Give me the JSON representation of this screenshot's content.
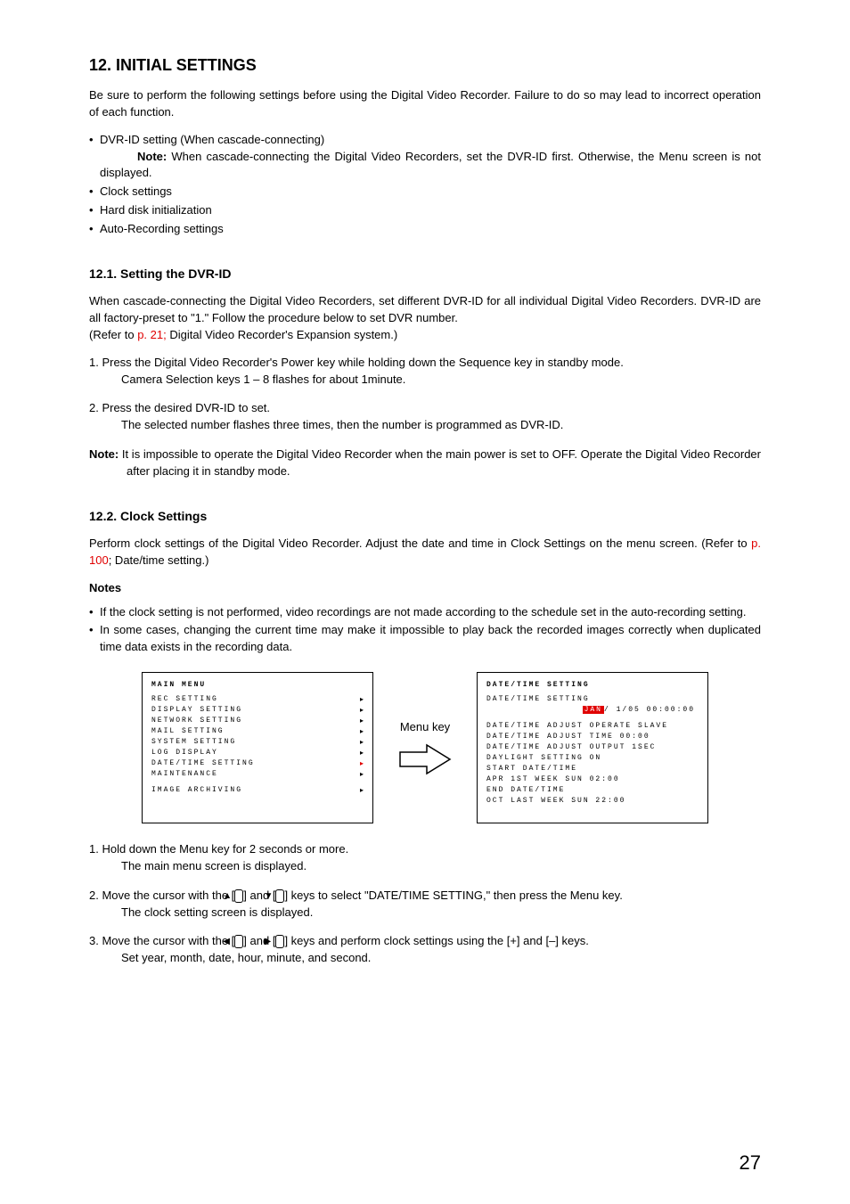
{
  "section": {
    "title": "12. INITIAL SETTINGS",
    "intro": "Be sure to perform the following settings before using the Digital Video Recorder. Failure to do so may lead to incorrect operation of each function.",
    "bullets": {
      "b1": "DVR-ID setting (When cascade-connecting)",
      "b1note_label": "Note:",
      "b1note": " When cascade-connecting the Digital Video Recorders, set the DVR-ID first. Otherwise, the Menu screen is not displayed.",
      "b2": "Clock settings",
      "b3": "Hard disk initialization",
      "b4": "Auto-Recording settings"
    }
  },
  "sub1": {
    "title": "12.1. Setting the DVR-ID",
    "p1a": "When cascade-connecting the Digital Video Recorders, set different DVR-ID for all individual Digital Video Recorders. DVR-ID are all factory-preset to \"1.\" Follow the procedure below to set DVR number.",
    "p1b_prefix": "(Refer to ",
    "p1b_link": "p. 21;",
    "p1b_suffix": " Digital Video Recorder's Expansion system.)",
    "s1": "1. Press the Digital Video Recorder's Power key while holding down the Sequence key in standby mode.",
    "s1b": "Camera Selection keys 1 – 8 flashes for about 1minute.",
    "s2": "2. Press the desired DVR-ID to set.",
    "s2b": "The selected number flashes three times, then the number is programmed as DVR-ID.",
    "note_label": "Note:",
    "note": " It is impossible to operate the Digital Video Recorder when the main power is set to OFF. Operate the Digital Video Recorder after placing it in standby mode."
  },
  "sub2": {
    "title": "12.2. Clock Settings",
    "p1_prefix": "Perform clock settings of the Digital Video Recorder. Adjust the date and time in Clock Settings on the menu screen. (Refer to ",
    "p1_link": "p. 100",
    "p1_suffix": "; Date/time setting.)",
    "notes_heading": "Notes",
    "n1": "If the clock setting is not performed, video recordings are not made according to the schedule set in the auto-recording setting.",
    "n2": "In some cases, changing the current time may make it impossible to play back the recorded images correctly when duplicated time data exists in the recording data.",
    "step1": "1. Hold down the Menu key for 2 seconds or more.",
    "step1b": "The main menu screen is displayed.",
    "step2a": "2. Move the cursor with the [",
    "step2b": "] and [",
    "step2c": "] keys to select \"DATE/TIME SETTING,\" then press the Menu key.",
    "step2d": "The clock setting screen is displayed.",
    "step3a": "3. Move the cursor with the [",
    "step3b": "] and [",
    "step3c": "] keys and perform clock settings using the [+] and [–] keys.",
    "step3d": "Set year, month, date, hour, minute, and second."
  },
  "screens": {
    "left": {
      "title": "MAIN MENU",
      "items": [
        "REC SETTING",
        "DISPLAY SETTING",
        "NETWORK SETTING",
        "MAIL SETTING",
        "SYSTEM SETTING",
        "LOG DISPLAY",
        "DATE/TIME SETTING",
        "MAINTENANCE",
        "IMAGE ARCHIVING"
      ]
    },
    "arrow_label": "Menu key",
    "right": {
      "title": "DATE/TIME SETTING",
      "line1_label": "DATE/TIME SETTING",
      "line1_hl": "JAN",
      "line1_rest": "/ 1/05 00:00:00",
      "line2": "DATE/TIME ADJUST OPERATE   SLAVE",
      "line3": "DATE/TIME ADJUST TIME      00:00",
      "line4": "DATE/TIME ADJUST OUTPUT     1SEC",
      "line5": "DAYLIGHT SETTING              ON",
      "line6": " START DATE/TIME",
      "line7": "          APR 1ST  WEEK SUN 02:00",
      "line8": " END DATE/TIME",
      "line9": "          OCT LAST WEEK SUN 22:00"
    }
  },
  "icons": {
    "up": "▲",
    "down": "▼",
    "left": "◀",
    "right": "▶"
  },
  "page_number": "27"
}
